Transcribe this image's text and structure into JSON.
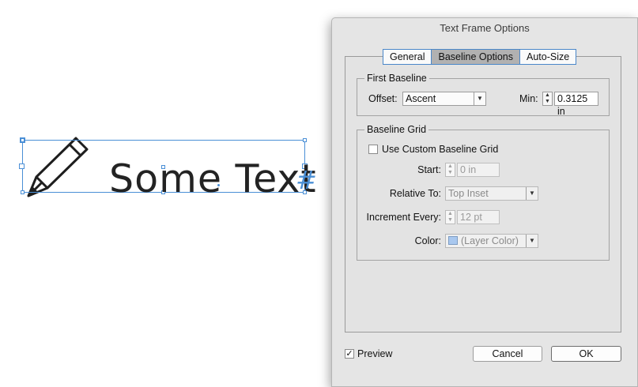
{
  "canvas": {
    "text": "Some Text",
    "overset_glyph": "#",
    "pencil_icon": "pencil-icon",
    "frame_color": "#4a8fd6"
  },
  "dialog": {
    "title": "Text Frame Options",
    "tabs": [
      {
        "label": "General",
        "active": false
      },
      {
        "label": "Baseline Options",
        "active": true
      },
      {
        "label": "Auto-Size",
        "active": false
      }
    ],
    "first_baseline": {
      "title": "First Baseline",
      "offset_label": "Offset:",
      "offset_value": "Ascent",
      "min_label": "Min:",
      "min_value": "0.3125 in"
    },
    "baseline_grid": {
      "title": "Baseline Grid",
      "use_custom_label": "Use Custom Baseline Grid",
      "use_custom_checked": false,
      "start_label": "Start:",
      "start_value": "0 in",
      "relative_to_label": "Relative To:",
      "relative_to_value": "Top Inset",
      "increment_label": "Increment Every:",
      "increment_value": "12 pt",
      "color_label": "Color:",
      "color_value": "(Layer Color)",
      "swatch_color": "#a9c8ef"
    },
    "preview_label": "Preview",
    "preview_checked": true,
    "cancel_label": "Cancel",
    "ok_label": "OK"
  }
}
